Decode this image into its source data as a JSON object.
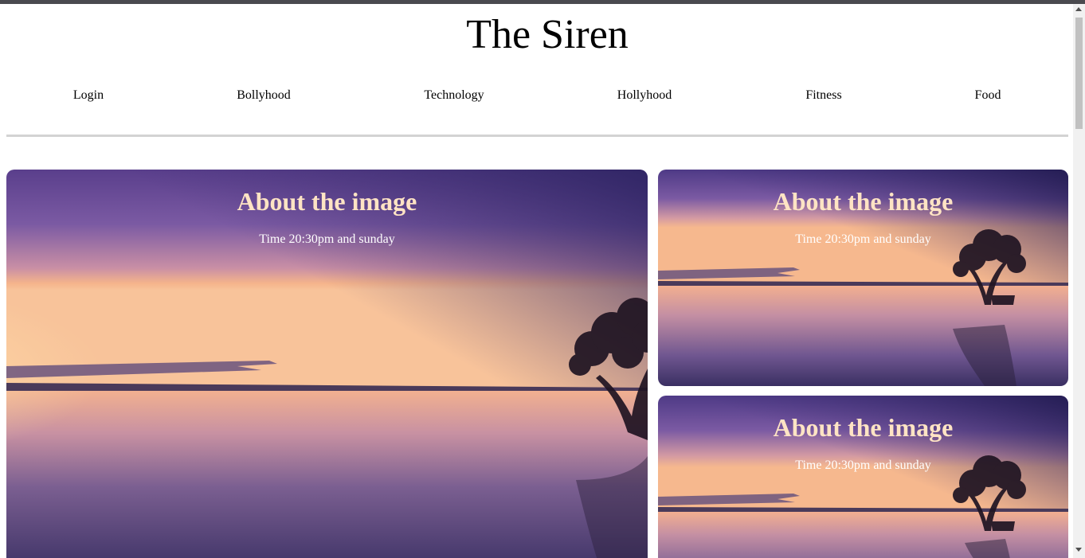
{
  "site": {
    "title": "The Siren"
  },
  "nav": {
    "items": [
      {
        "label": "Login"
      },
      {
        "label": "Bollyhood"
      },
      {
        "label": "Technology"
      },
      {
        "label": "Hollyhood"
      },
      {
        "label": "Fitness"
      },
      {
        "label": "Food"
      }
    ]
  },
  "cards": [
    {
      "heading": "About the image",
      "caption": "Time 20:30pm and sunday"
    },
    {
      "heading": "About the image",
      "caption": "Time 20:30pm and sunday"
    },
    {
      "heading": "About the image",
      "caption": "Time 20:30pm and sunday"
    }
  ],
  "colors": {
    "heading": "#ffe4c4",
    "caption": "#ffffff",
    "sky_top": "#2e2563",
    "sky_mid": "#7d5aa0",
    "horizon_glow": "#f7b98c",
    "water": "#4b3f78"
  }
}
